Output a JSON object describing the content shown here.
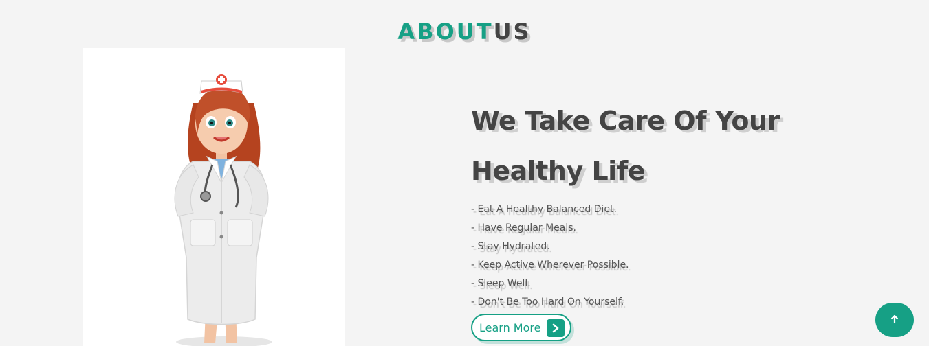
{
  "section": {
    "title_accent": "ABOUT",
    "title_rest": "US"
  },
  "about": {
    "headline": "We Take Care Of Your Healthy Life",
    "tips": [
      "- Eat A Healthy Balanced Diet.",
      "- Have Regular Meals.",
      "- Stay Hydrated.",
      "- Keep Active Wherever Possible.",
      "- Sleep Well.",
      "- Don't Be Too Hard On Yourself."
    ],
    "button_label": "Learn More"
  },
  "colors": {
    "accent": "#16a085",
    "text_dark": "#444444",
    "background": "#f4f4f4"
  },
  "icons": {
    "button_icon": "chevron-right-icon",
    "scroll_top_icon": "arrow-up-icon",
    "illustration": "nurse-illustration"
  }
}
